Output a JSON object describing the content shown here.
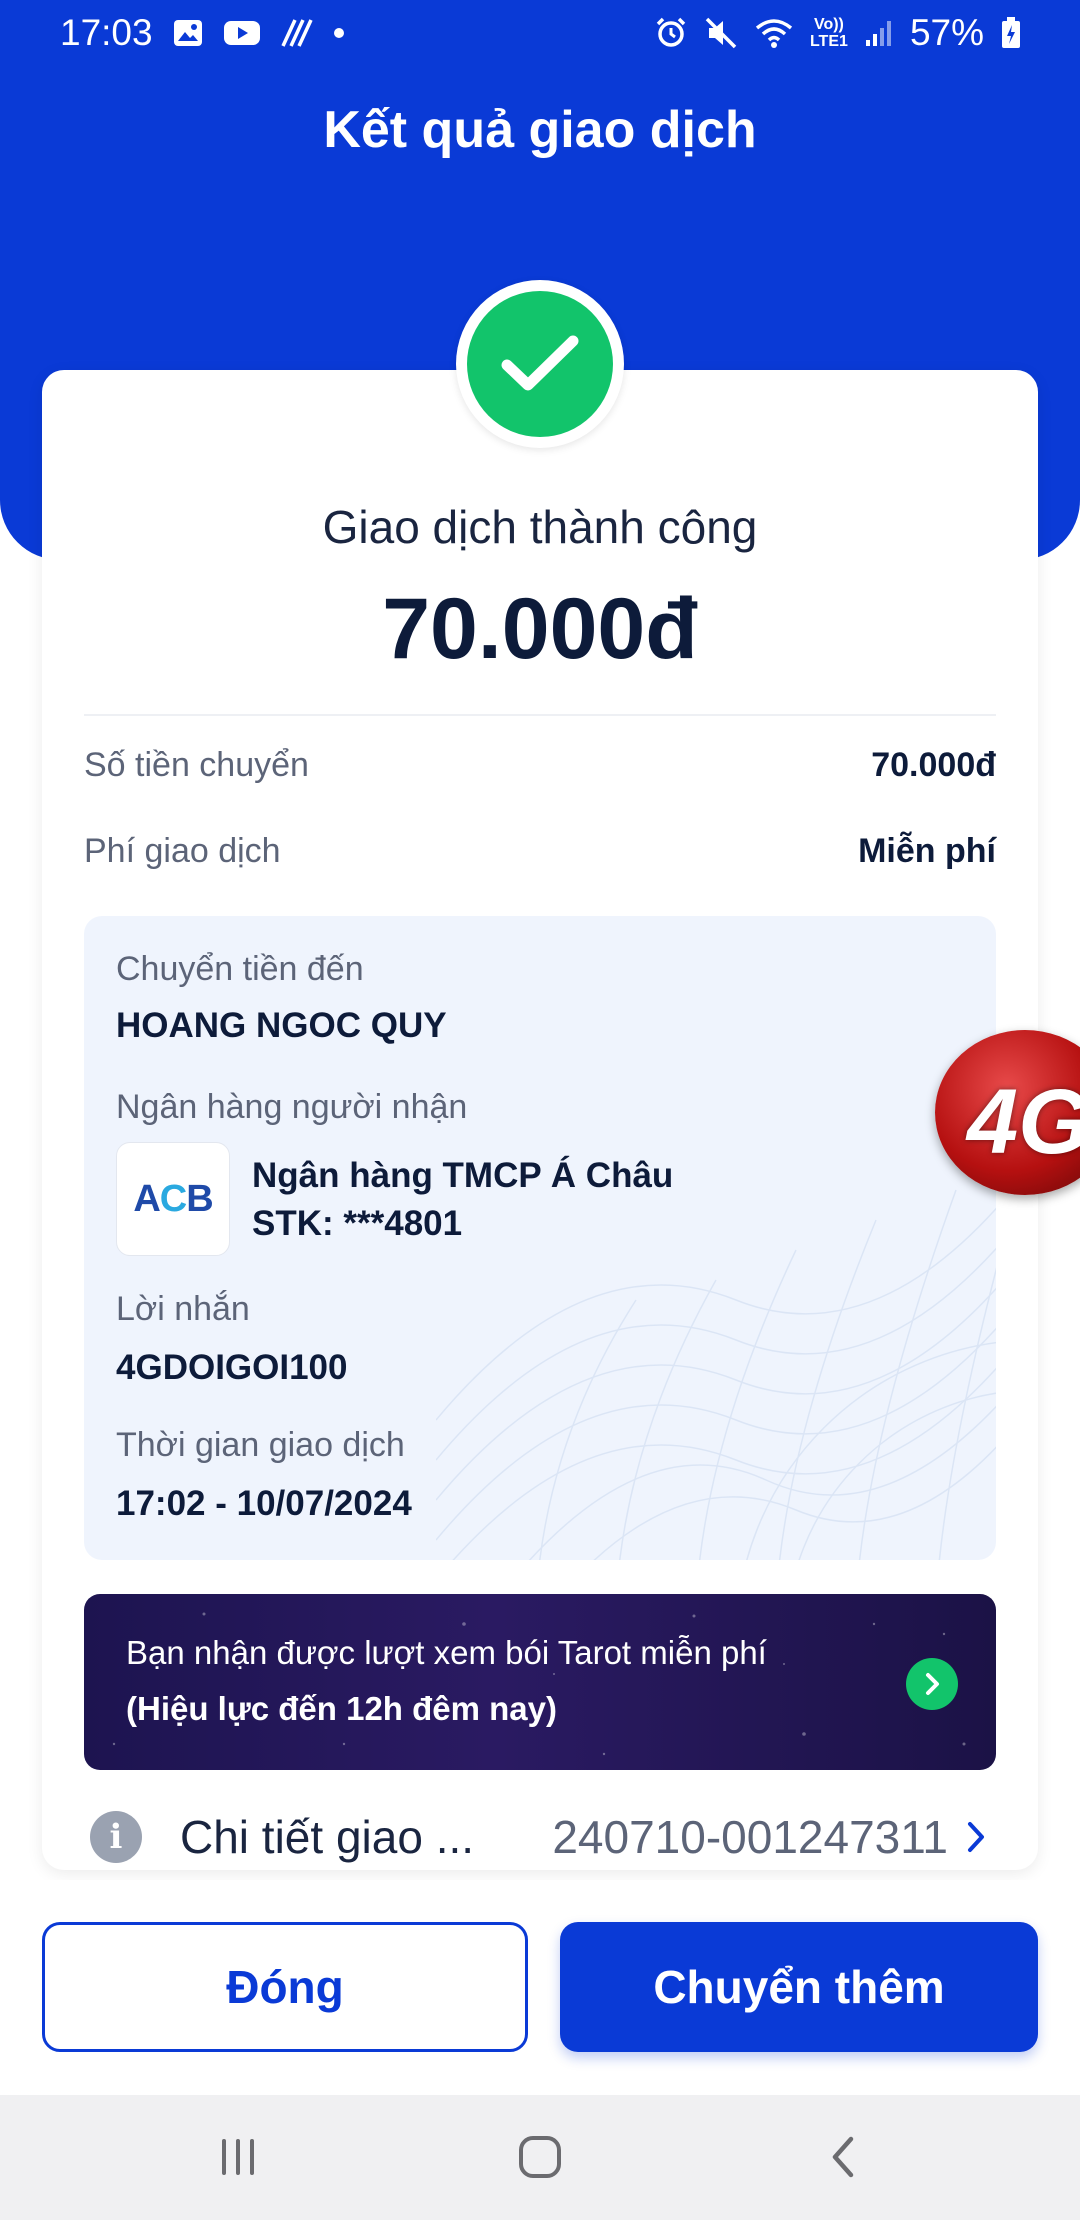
{
  "status_bar": {
    "time": "17:03",
    "battery": "57%",
    "network_label": "Vo)) LTE1",
    "icons": [
      "gallery-icon",
      "youtube-icon",
      "data-saver-icon",
      "dot-icon",
      "alarm-icon",
      "mute-icon",
      "wifi-icon",
      "signal-icon",
      "battery-icon"
    ]
  },
  "header": {
    "title": "Kết quả giao dịch"
  },
  "result": {
    "status_text": "Giao dịch thành công",
    "amount": "70.000đ"
  },
  "summary": [
    {
      "label": "Số tiền chuyển",
      "value": "70.000đ"
    },
    {
      "label": "Phí giao dịch",
      "value": "Miễn phí"
    }
  ],
  "recipient": {
    "to_label": "Chuyển tiền đến",
    "to_name": "HOANG NGOC QUY",
    "bank_label": "Ngân hàng người nhận",
    "bank_logo_a": "A",
    "bank_logo_c": "C",
    "bank_logo_b": "B",
    "bank_name": "Ngân hàng TMCP Á Châu",
    "account": "STK: ***4801",
    "message_label": "Lời nhắn",
    "message": "4GDOIGOI100",
    "time_label": "Thời gian giao dịch",
    "time": "17:02 - 10/07/2024"
  },
  "promo": {
    "line1": "Bạn nhận được lượt xem bói Tarot miễn phí",
    "line2": "(Hiệu lực đến 12h đêm nay)"
  },
  "detail": {
    "label": "Chi tiết giao ...",
    "transaction_id": "240710-001247311"
  },
  "buttons": {
    "close_label": "Đóng",
    "more_label": "Chuyển thêm"
  },
  "floating_bubble": {
    "label": "4G"
  },
  "colors": {
    "primary": "#0a3ad6",
    "success": "#12c46b",
    "text_dark": "#0d1b3a",
    "text_muted": "#5c6478",
    "info_box_bg": "#eff4fd"
  }
}
